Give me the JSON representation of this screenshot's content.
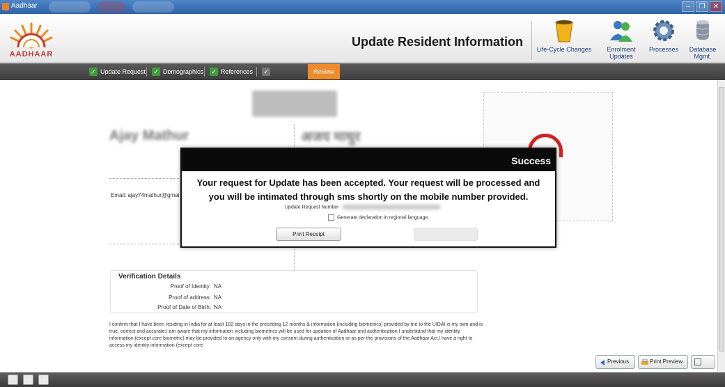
{
  "window": {
    "title": "Aadhaar",
    "controls": {
      "minimize": "–",
      "maximize": "❐",
      "close": "✕"
    }
  },
  "header": {
    "logo_text": "AADHAAR",
    "page_title": "Update Resident Information",
    "toolbar": [
      {
        "label": "Life-Cycle Changes",
        "icon": "life-cycle-bucket-icon"
      },
      {
        "label": "Enrolment Updates",
        "icon": "users-icon"
      },
      {
        "label": "Processes",
        "icon": "gear-icon"
      },
      {
        "label": "Database Mgmt.",
        "icon": "database-icon"
      }
    ]
  },
  "nav": {
    "tabs": [
      {
        "label": "Update Request",
        "state": "complete"
      },
      {
        "label": "Demographics",
        "state": "complete"
      },
      {
        "label": "References",
        "state": "complete"
      },
      {
        "label": "",
        "state": "disabled"
      },
      {
        "label": "Review",
        "state": "active"
      }
    ]
  },
  "resident": {
    "name_en": "Ajay Mathur",
    "name_hi": "अजय माथुर",
    "email": "Email: ajay74mathur@gmai"
  },
  "verification": {
    "title": "Verification Details",
    "rows": [
      {
        "label": "Proof of Identity:",
        "value": "NA"
      },
      {
        "label": "Proof of address:",
        "value": "NA"
      },
      {
        "label": "Proof of Date of Birth:",
        "value": "NA"
      }
    ]
  },
  "declaration": "I confirm that I have been residing in India for at least 182 days in the preceding 12 months & information (including biometrics) provided by me to the UIDAI is my own and is true, correct and accurate.I am aware that my information including biometrics will be used for updation of Aadhaar and authentication.I understand that my identity information (except core biometric) may be provided to an agency only with my consent during authentication or as per the provisions of the Aadhaar Act.I have a right to access my identity information (except core",
  "footer_buttons": {
    "previous": "Previous",
    "print_preview": "Print Preview"
  },
  "modal": {
    "title": "Success",
    "message_line1": "Your request for Update has been accepted. Your request will be processed and",
    "message_line2": "you will be intimated through sms shortly on the mobile number provided.",
    "request_number_label": "Update Request Number",
    "regional_checkbox_label": "Generate declaration in regional language.",
    "print_receipt": "Print Receipt"
  },
  "colors": {
    "nav_active": "#f08a2a",
    "nav_check": "#3f9e3a",
    "modal_header": "#0a0a0a",
    "title_bar": "#2f62a8"
  }
}
